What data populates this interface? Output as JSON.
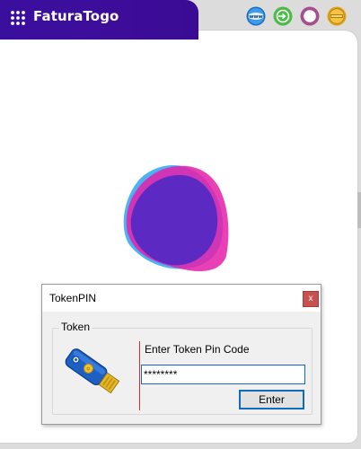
{
  "app": {
    "title": "FaturaTogo",
    "menu_icon": "grid-menu-icon",
    "toolbar_icons": [
      {
        "name": "www-icon",
        "label": "www"
      },
      {
        "name": "login-icon"
      },
      {
        "name": "ring-icon"
      },
      {
        "name": "badge-icon"
      }
    ],
    "colors": {
      "brand": "#3b0f9e",
      "background": "#ffffff",
      "logo_blue": "#2aa6f2",
      "logo_magenta": "#e61ea8",
      "logo_purple": "#4428c9"
    }
  },
  "dialog": {
    "title": "TokenPIN",
    "close_label": "x",
    "group_label": "Token",
    "prompt": "Enter Token Pin Code",
    "pin_value": "********",
    "enter_label": "Enter"
  }
}
